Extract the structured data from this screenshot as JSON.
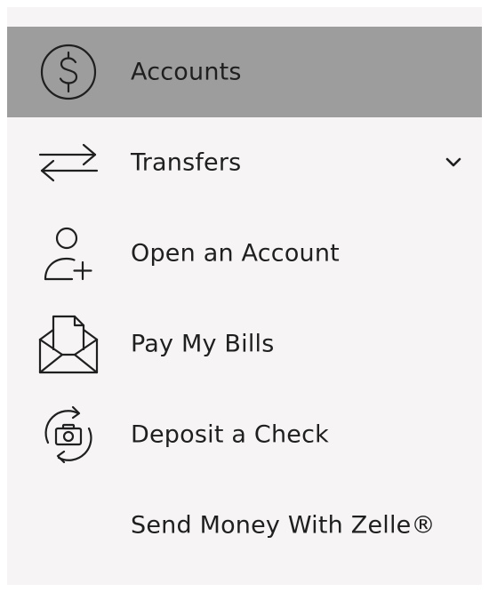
{
  "menu": {
    "items": [
      {
        "label": "Accounts",
        "icon": "dollar-circle-icon",
        "active": true
      },
      {
        "label": "Transfers",
        "icon": "transfer-arrows-icon",
        "expandable": true
      },
      {
        "label": "Open an Account",
        "icon": "add-user-icon"
      },
      {
        "label": "Pay My Bills",
        "icon": "envelope-bill-icon"
      },
      {
        "label": "Deposit a Check",
        "icon": "camera-deposit-icon"
      },
      {
        "label": "Send Money With Zelle®",
        "icon": ""
      }
    ]
  },
  "colors": {
    "menu_background": "#f6f4f4",
    "active_background": "#9d9d9d",
    "text": "#1f1f1f",
    "icon_stroke": "#1f1f1f"
  }
}
